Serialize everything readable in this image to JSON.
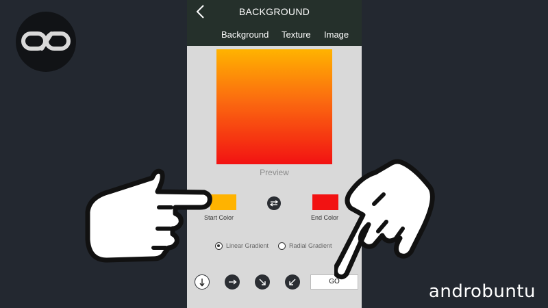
{
  "brand": {
    "watermark": "androbuntu"
  },
  "app": {
    "title": "BACKGROUND",
    "tabs": [
      {
        "label": "Background"
      },
      {
        "label": "Texture"
      },
      {
        "label": "Image"
      }
    ]
  },
  "preview": {
    "label": "Preview",
    "gradient_start_color": "#ffb300",
    "gradient_end_color": "#f21212"
  },
  "colors": {
    "start_label": "Start Color",
    "start_value": "#ffb300",
    "end_label": "End Color",
    "end_value": "#f21212"
  },
  "gradient_type": {
    "options": [
      {
        "label": "Linear Gradient",
        "selected": true
      },
      {
        "label": "Radial Gradient",
        "selected": false
      }
    ]
  },
  "directions": [
    {
      "icon": "arrow-down-icon",
      "selected": true
    },
    {
      "icon": "arrow-right-icon",
      "selected": false
    },
    {
      "icon": "arrow-down-right-icon",
      "selected": false
    },
    {
      "icon": "arrow-down-left-icon",
      "selected": false
    }
  ],
  "go_button": {
    "label": "GO"
  },
  "theme": {
    "page_background": "#232830",
    "topbar_background": "#25302b",
    "panel_background": "#d9d9d9"
  }
}
